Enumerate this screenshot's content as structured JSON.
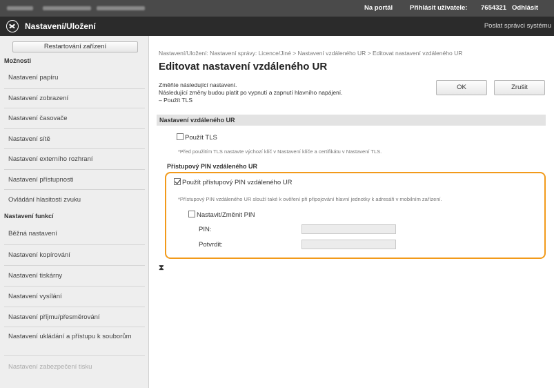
{
  "topbar": {
    "portal_link": "Na portál",
    "login_label": "Přihlásit uživatele:",
    "login_user": "7654321",
    "logout": "Odhlásit"
  },
  "titlebar": {
    "app_title": "Nastavení/Uložení",
    "send_mail": "Poslat správci systému"
  },
  "sidebar": {
    "restart_button": "Restartování zařízení",
    "sections": [
      {
        "title": "Možnosti",
        "items": [
          "Nastavení papíru",
          "Nastavení zobrazení",
          "Nastavení časovače",
          "Nastavení sítě",
          "Nastavení externího rozhraní",
          "Nastavení přístupnosti",
          "Ovládání hlasitosti zvuku"
        ]
      },
      {
        "title": "Nastavení funkcí",
        "items": [
          "Běžná nastavení",
          "Nastavení kopírování",
          "Nastavení tiskárny",
          "Nastavení vysílání",
          "Nastavení příjmu/přesměrování",
          "Nastavení ukládání a přístupu k souborům",
          "Nastavení zabezpečení tisku"
        ]
      }
    ]
  },
  "main": {
    "breadcrumb": "Nastavení/Uložení: Nastavení správy: Licence/Jiné > Nastavení vzdáleného UR > Editovat nastavení vzdáleného UR",
    "title": "Editovat nastavení vzdáleného UR",
    "description_lines": [
      "Změňte následující nastavení.",
      "Následující změny budou platit po vypnutí a zapnutí hlavního napájení.",
      "– Použít TLS"
    ],
    "ok_button": "OK",
    "cancel_button": "Zrušit",
    "section_title": "Nastavení vzdáleného UR",
    "use_tls": {
      "label": "Použít TLS",
      "checked": false
    },
    "tls_note": "*Před použitím TLS nastavte výchozí klíč v Nastavení klíče a certifikátu v Nastavení TLS.",
    "pin_subhead": "Přístupový PIN vzdáleného UR",
    "use_pin": {
      "label": "Použít přístupový PIN vzdáleného UR",
      "checked": true
    },
    "pin_note": "*Přístupový PIN vzdáleného UR slouží také k ověření při připojování hlavní jednotky k adresáři v mobilním zařízení.",
    "set_change_pin": {
      "label": "Nastavit/Změnit PIN",
      "checked": false
    },
    "pin_label": "PIN:",
    "pin_value": "",
    "confirm_label": "Potvrdit:",
    "confirm_value": "",
    "highlight_color": "#f29a1a",
    "back_to_top_icon": "back-to-top-icon",
    "back_to_top_symbol": "⧗"
  }
}
